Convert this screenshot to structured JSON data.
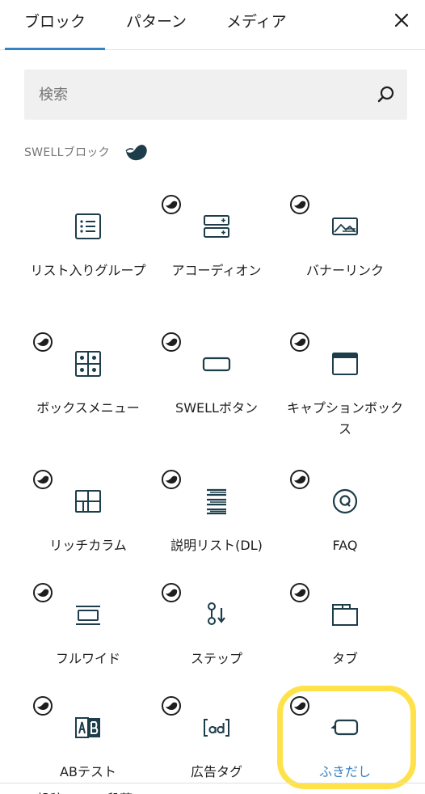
{
  "tabs": [
    {
      "label": "ブロック",
      "active": true
    },
    {
      "label": "パターン",
      "active": false
    },
    {
      "label": "メディア",
      "active": false
    }
  ],
  "close_icon": "close-icon",
  "search": {
    "placeholder": "検索",
    "value": ""
  },
  "section": {
    "title": "SWELLブロック",
    "logo": "swell-logo-icon"
  },
  "blocks": [
    {
      "label": "リスト入りグループ",
      "icon": "list-icon",
      "badge": false
    },
    {
      "label": "アコーディオン",
      "icon": "accordion-icon",
      "badge": true
    },
    {
      "label": "バナーリンク",
      "icon": "banner-icon",
      "badge": true
    },
    {
      "label": "ボックスメニュー",
      "icon": "box-menu-icon",
      "badge": true
    },
    {
      "label": "SWELLボタン",
      "icon": "button-icon",
      "badge": true
    },
    {
      "label": "キャプションボックス",
      "icon": "caption-box-icon",
      "badge": true
    },
    {
      "label": "リッチカラム",
      "icon": "columns-icon",
      "badge": true
    },
    {
      "label": "説明リスト(DL)",
      "icon": "description-list-icon",
      "badge": true
    },
    {
      "label": "FAQ",
      "icon": "faq-icon",
      "badge": true
    },
    {
      "label": "フルワイド",
      "icon": "full-wide-icon",
      "badge": true
    },
    {
      "label": "ステップ",
      "icon": "step-icon",
      "badge": true
    },
    {
      "label": "タブ",
      "icon": "tab-icon",
      "badge": true
    },
    {
      "label": "ABテスト",
      "icon": "ab-test-icon",
      "badge": true
    },
    {
      "label": "広告タグ",
      "icon": "ad-tag-icon",
      "badge": true
    },
    {
      "label": "ふきだし",
      "icon": "speech-balloon-icon",
      "badge": true,
      "selected": true
    }
  ],
  "bottom_partial": [
    "投稿",
    "段落"
  ],
  "colors": {
    "accent": "#3582c4",
    "icon": "#1d3d4a",
    "highlight": "#ffde3a",
    "muted": "#757575"
  }
}
